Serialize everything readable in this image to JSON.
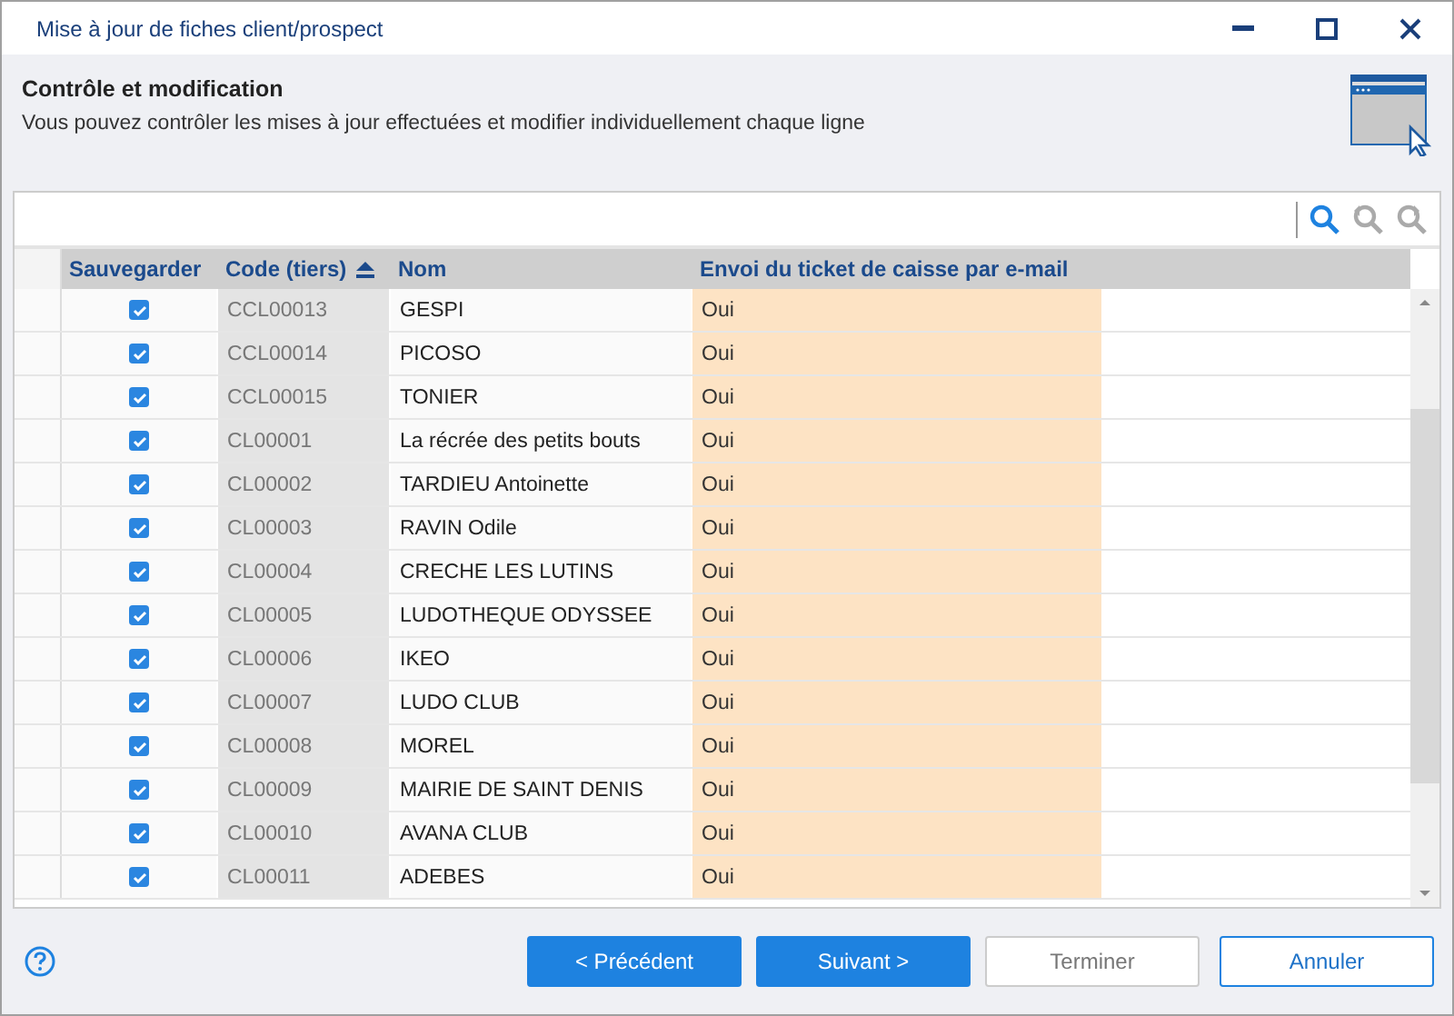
{
  "window": {
    "title": "Mise à jour de fiches client/prospect"
  },
  "header": {
    "title": "Contrôle et modification",
    "subtitle": "Vous pouvez contrôler les mises à jour effectuées et modifier individuellement chaque ligne"
  },
  "table": {
    "columns": [
      {
        "label": "Sauvegarder",
        "sorted": false
      },
      {
        "label": "Code (tiers)",
        "sorted": true
      },
      {
        "label": "Nom",
        "sorted": false
      },
      {
        "label": "Envoi du ticket de caisse par e-mail",
        "sorted": false
      }
    ],
    "rows": [
      {
        "checked": true,
        "code": "CCL00013",
        "name": "GESPI",
        "email_ticket": "Oui"
      },
      {
        "checked": true,
        "code": "CCL00014",
        "name": "PICOSO",
        "email_ticket": "Oui"
      },
      {
        "checked": true,
        "code": "CCL00015",
        "name": "TONIER",
        "email_ticket": "Oui"
      },
      {
        "checked": true,
        "code": "CL00001",
        "name": "La récrée des petits bouts",
        "email_ticket": "Oui"
      },
      {
        "checked": true,
        "code": "CL00002",
        "name": "TARDIEU Antoinette",
        "email_ticket": "Oui"
      },
      {
        "checked": true,
        "code": "CL00003",
        "name": "RAVIN Odile",
        "email_ticket": "Oui"
      },
      {
        "checked": true,
        "code": "CL00004",
        "name": "CRECHE LES LUTINS",
        "email_ticket": "Oui"
      },
      {
        "checked": true,
        "code": "CL00005",
        "name": "LUDOTHEQUE ODYSSEE",
        "email_ticket": "Oui"
      },
      {
        "checked": true,
        "code": "CL00006",
        "name": "IKEO",
        "email_ticket": "Oui"
      },
      {
        "checked": true,
        "code": "CL00007",
        "name": "LUDO CLUB",
        "email_ticket": "Oui"
      },
      {
        "checked": true,
        "code": "CL00008",
        "name": "MOREL",
        "email_ticket": "Oui"
      },
      {
        "checked": true,
        "code": "CL00009",
        "name": "MAIRIE DE SAINT DENIS",
        "email_ticket": "Oui"
      },
      {
        "checked": true,
        "code": "CL00010",
        "name": "AVANA CLUB",
        "email_ticket": "Oui"
      },
      {
        "checked": true,
        "code": "CL00011",
        "name": "ADEBES",
        "email_ticket": "Oui"
      }
    ]
  },
  "buttons": [
    {
      "label": "< Précédent",
      "kind": "primary",
      "disabled": false
    },
    {
      "label": "Suivant >",
      "kind": "primary",
      "disabled": false
    },
    {
      "label": "Terminer",
      "kind": "secondary",
      "disabled": true
    },
    {
      "label": "Annuler",
      "kind": "outline",
      "disabled": false
    }
  ]
}
